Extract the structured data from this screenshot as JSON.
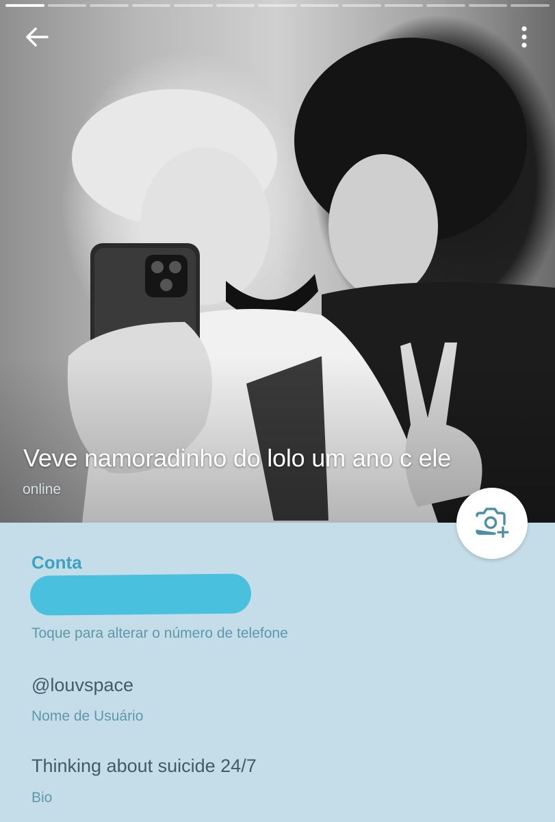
{
  "story": {
    "segments_total": 13,
    "segments_done": 1
  },
  "header": {
    "back_icon": "arrow-back-icon",
    "menu_icon": "more-vertical-icon",
    "name": "Veve namoradinho do lolo um ano c ele",
    "status": "online",
    "camera_icon": "add-photo-icon"
  },
  "account": {
    "section_title": "Conta",
    "phone_hint": "Toque para alterar o número de telefone",
    "username": "@louvspace",
    "username_hint": "Nome de Usuário",
    "bio": "Thinking about suicide 24/7",
    "bio_hint": "Bio"
  },
  "colors": {
    "accent": "#3aa3c4",
    "background": "#c5dde8",
    "redaction": "#49c0de",
    "value_text": "#3f5c66",
    "hint_text": "#5d98a9"
  }
}
